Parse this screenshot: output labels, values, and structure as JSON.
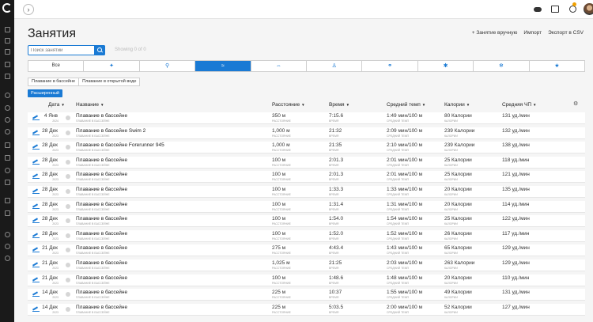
{
  "header": {
    "title": "Занятия",
    "links": [
      "+ Занятие вручную",
      "Импорт",
      "Экспорт в CSV"
    ]
  },
  "search": {
    "placeholder": "Поиск занятий",
    "count_text": "Showing 0 of 0"
  },
  "activity_types": [
    {
      "label": "Все",
      "icon": "all-text"
    },
    {
      "label": "",
      "icon": "running-icon"
    },
    {
      "label": "",
      "icon": "cycling-icon"
    },
    {
      "label": "",
      "icon": "swimming-icon"
    },
    {
      "label": "",
      "icon": "multisport-icon"
    },
    {
      "label": "",
      "icon": "walking-icon"
    },
    {
      "label": "",
      "icon": "fitness-equipment-icon"
    },
    {
      "label": "",
      "icon": "strength-icon"
    },
    {
      "label": "",
      "icon": "winter-sports-icon"
    },
    {
      "label": "",
      "icon": "other-icon"
    }
  ],
  "active_type_index": 3,
  "subtypes": [
    "Плавание в бассейне",
    "Плавание в открытой воде"
  ],
  "advanced_label": "Расширенный",
  "columns": {
    "date": "Дата",
    "name": "Название",
    "distance": "Расстояние",
    "time": "Время",
    "pace": "Средний темп",
    "calories": "Калории",
    "hr": "Средняя ЧП"
  },
  "sub_labels": {
    "name": "плавание в бассейне",
    "distance": "расстояние",
    "time": "время",
    "pace": "средний темп",
    "calories": "калории"
  },
  "rows": [
    {
      "date": "4 Янв",
      "year": "2024",
      "name": "Плавание в бассейне",
      "distance": "350 м",
      "time": "7:15.6",
      "pace": "1:49 мин/100 м",
      "calories": "80 Калории",
      "hr": "131 уд./мин"
    },
    {
      "date": "28 Дек",
      "year": "2023",
      "name": "Плавание в бассейне Swim 2",
      "distance": "1,000 м",
      "time": "21:32",
      "pace": "2:09 мин/100 м",
      "calories": "239 Калории",
      "hr": "132 уд./мин"
    },
    {
      "date": "28 Дек",
      "year": "2023",
      "name": "Плавание в бассейне Forerunner 945",
      "distance": "1,000 м",
      "time": "21:35",
      "pace": "2:10 мин/100 м",
      "calories": "239 Калории",
      "hr": "138 уд./мин"
    },
    {
      "date": "28 Дек",
      "year": "2023",
      "name": "Плавание в бассейне",
      "distance": "100 м",
      "time": "2:01.3",
      "pace": "2:01 мин/100 м",
      "calories": "25 Калории",
      "hr": "118 уд./мин"
    },
    {
      "date": "28 Дек",
      "year": "2023",
      "name": "Плавание в бассейне",
      "distance": "100 м",
      "time": "2:01.3",
      "pace": "2:01 мин/100 м",
      "calories": "25 Калории",
      "hr": "121 уд./мин"
    },
    {
      "date": "28 Дек",
      "year": "2023",
      "name": "Плавание в бассейне",
      "distance": "100 м",
      "time": "1:33.3",
      "pace": "1:33 мин/100 м",
      "calories": "20 Калории",
      "hr": "135 уд./мин"
    },
    {
      "date": "28 Дек",
      "year": "2023",
      "name": "Плавание в бассейне",
      "distance": "100 м",
      "time": "1:31.4",
      "pace": "1:31 мин/100 м",
      "calories": "20 Калории",
      "hr": "114 уд./мин"
    },
    {
      "date": "28 Дек",
      "year": "2023",
      "name": "Плавание в бассейне",
      "distance": "100 м",
      "time": "1:54.0",
      "pace": "1:54 мин/100 м",
      "calories": "25 Калории",
      "hr": "122 уд./мин"
    },
    {
      "date": "28 Дек",
      "year": "2023",
      "name": "Плавание в бассейне",
      "distance": "100 м",
      "time": "1:52.0",
      "pace": "1:52 мин/100 м",
      "calories": "26 Калории",
      "hr": "117 уд./мин"
    },
    {
      "date": "21 Дек",
      "year": "2023",
      "name": "Плавание в бассейне",
      "distance": "275 м",
      "time": "4:43.4",
      "pace": "1:43 мин/100 м",
      "calories": "65 Калории",
      "hr": "129 уд./мин"
    },
    {
      "date": "21 Дек",
      "year": "2023",
      "name": "Плавание в бассейне",
      "distance": "1,025 м",
      "time": "21:25",
      "pace": "2:03 мин/100 м",
      "calories": "263 Калории",
      "hr": "129 уд./мин"
    },
    {
      "date": "21 Дек",
      "year": "2023",
      "name": "Плавание в бассейне",
      "distance": "100 м",
      "time": "1:48.6",
      "pace": "1:48 мин/100 м",
      "calories": "20 Калории",
      "hr": "110 уд./мин"
    },
    {
      "date": "14 Дек",
      "year": "2023",
      "name": "Плавание в бассейне",
      "distance": "225 м",
      "time": "10:37",
      "pace": "1:55 мин/100 м",
      "calories": "49 Калории",
      "hr": "131 уд./мин"
    },
    {
      "date": "14 Дек",
      "year": "2023",
      "name": "Плавание в бассейне",
      "distance": "225 м",
      "time": "5:03.5",
      "pace": "2:00 мин/100 м",
      "calories": "52 Калории",
      "hr": "127 уд./мин"
    }
  ]
}
